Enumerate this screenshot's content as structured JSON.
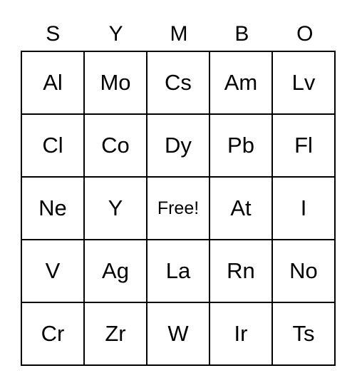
{
  "header": [
    "S",
    "Y",
    "M",
    "B",
    "O"
  ],
  "cells": [
    [
      "Al",
      "Mo",
      "Cs",
      "Am",
      "Lv"
    ],
    [
      "Cl",
      "Co",
      "Dy",
      "Pb",
      "Fl"
    ],
    [
      "Ne",
      "Y",
      "Free!",
      "At",
      "I"
    ],
    [
      "V",
      "Ag",
      "La",
      "Rn",
      "No"
    ],
    [
      "Cr",
      "Zr",
      "W",
      "Ir",
      "Ts"
    ]
  ]
}
